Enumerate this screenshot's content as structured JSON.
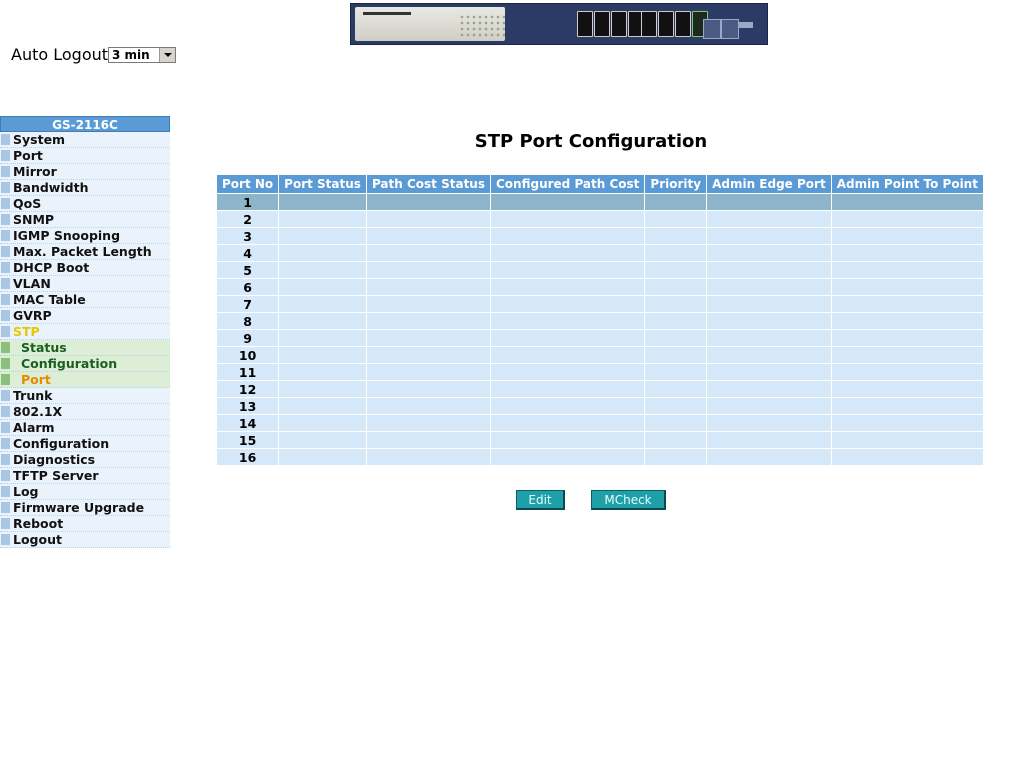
{
  "header": {
    "auto_logout_label": "Auto Logout",
    "auto_logout_value": "3 min"
  },
  "sidebar": {
    "title": "GS-2116C",
    "items": [
      {
        "label": "System",
        "level": 0
      },
      {
        "label": "Port",
        "level": 0
      },
      {
        "label": "Mirror",
        "level": 0
      },
      {
        "label": "Bandwidth",
        "level": 0
      },
      {
        "label": "QoS",
        "level": 0
      },
      {
        "label": "SNMP",
        "level": 0
      },
      {
        "label": "IGMP Snooping",
        "level": 0
      },
      {
        "label": "Max. Packet Length",
        "level": 0
      },
      {
        "label": "DHCP Boot",
        "level": 0
      },
      {
        "label": "VLAN",
        "level": 0
      },
      {
        "label": "MAC Table",
        "level": 0
      },
      {
        "label": "GVRP",
        "level": 0
      },
      {
        "label": "STP",
        "level": 0,
        "active": true
      },
      {
        "label": "Status",
        "level": 1
      },
      {
        "label": "Configuration",
        "level": 1
      },
      {
        "label": "Port",
        "level": 1,
        "current": true
      },
      {
        "label": "Trunk",
        "level": 0
      },
      {
        "label": "802.1X",
        "level": 0
      },
      {
        "label": "Alarm",
        "level": 0
      },
      {
        "label": "Configuration",
        "level": 0
      },
      {
        "label": "Diagnostics",
        "level": 0
      },
      {
        "label": "TFTP Server",
        "level": 0
      },
      {
        "label": "Log",
        "level": 0
      },
      {
        "label": "Firmware Upgrade",
        "level": 0
      },
      {
        "label": "Reboot",
        "level": 0
      },
      {
        "label": "Logout",
        "level": 0
      }
    ]
  },
  "main": {
    "title": "STP Port Configuration",
    "columns": [
      "Port No",
      "Port Status",
      "Path Cost Status",
      "Configured Path Cost",
      "Priority",
      "Admin Edge Port",
      "Admin Point To Point"
    ],
    "rows": [
      [
        "1",
        "",
        "",
        "",
        "",
        "",
        ""
      ],
      [
        "2",
        "",
        "",
        "",
        "",
        "",
        ""
      ],
      [
        "3",
        "",
        "",
        "",
        "",
        "",
        ""
      ],
      [
        "4",
        "",
        "",
        "",
        "",
        "",
        ""
      ],
      [
        "5",
        "",
        "",
        "",
        "",
        "",
        ""
      ],
      [
        "6",
        "",
        "",
        "",
        "",
        "",
        ""
      ],
      [
        "7",
        "",
        "",
        "",
        "",
        "",
        ""
      ],
      [
        "8",
        "",
        "",
        "",
        "",
        "",
        ""
      ],
      [
        "9",
        "",
        "",
        "",
        "",
        "",
        ""
      ],
      [
        "10",
        "",
        "",
        "",
        "",
        "",
        ""
      ],
      [
        "11",
        "",
        "",
        "",
        "",
        "",
        ""
      ],
      [
        "12",
        "",
        "",
        "",
        "",
        "",
        ""
      ],
      [
        "13",
        "",
        "",
        "",
        "",
        "",
        ""
      ],
      [
        "14",
        "",
        "",
        "",
        "",
        "",
        ""
      ],
      [
        "15",
        "",
        "",
        "",
        "",
        "",
        ""
      ],
      [
        "16",
        "",
        "",
        "",
        "",
        "",
        ""
      ]
    ],
    "selected_row": 0,
    "buttons": {
      "edit": "Edit",
      "mcheck": "MCheck"
    }
  },
  "colors": {
    "header_blue": "#5b9bd5",
    "row_bg": "#d6e9fa",
    "selected_row_bg": "#8db5c9",
    "button_teal": "#1f9fa8",
    "active_menu": "#e6c800",
    "current_submenu": "#e68a00"
  }
}
